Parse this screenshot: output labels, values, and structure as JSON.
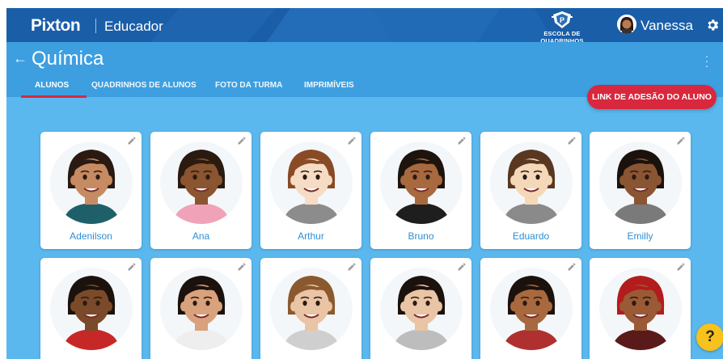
{
  "header": {
    "logo": "Pixton",
    "product": "Educador",
    "school_label": "ESCOLA DE QUADRINHOS",
    "user_name": "Vanessa"
  },
  "classroom": {
    "title": "Química",
    "tabs": [
      {
        "label": "ALUNOS",
        "active": true
      },
      {
        "label": "QUADRINHOS DE ALUNOS",
        "active": false
      },
      {
        "label": "FOTO DA TURMA",
        "active": false
      },
      {
        "label": "IMPRIMÍVEIS",
        "active": false
      }
    ],
    "join_link_button": "LINK DE ADESÃO DO ALUNO"
  },
  "students": [
    {
      "name": "Adenilson",
      "skin": "#c68b62",
      "hair": "#2a1a12",
      "shirt": "#1f5f6a"
    },
    {
      "name": "Ana",
      "skin": "#8a5530",
      "hair": "#2b1a10",
      "shirt": "#f0a3b8"
    },
    {
      "name": "Arthur",
      "skin": "#f6dcc4",
      "hair": "#8a4a26",
      "shirt": "#8c8c8c"
    },
    {
      "name": "Bruno",
      "skin": "#a8693e",
      "hair": "#1e140e",
      "shirt": "#1e1e1e"
    },
    {
      "name": "Eduardo",
      "skin": "#f5d8b8",
      "hair": "#5a3720",
      "shirt": "#8a8a8a"
    },
    {
      "name": "Emilly",
      "skin": "#8a5533",
      "hair": "#1b120d",
      "shirt": "#7a7a7a"
    },
    {
      "name": "",
      "skin": "#7a4a2a",
      "hair": "#1b120d",
      "shirt": "#c62828"
    },
    {
      "name": "",
      "skin": "#d9a27c",
      "hair": "#1b120d",
      "shirt": "#eeeeee"
    },
    {
      "name": "",
      "skin": "#e9c4a5",
      "hair": "#8a5a2e",
      "shirt": "#cfcfcf"
    },
    {
      "name": "",
      "skin": "#e9c4a5",
      "hair": "#1b120d",
      "shirt": "#bdbdbd"
    },
    {
      "name": "",
      "skin": "#a8693e",
      "hair": "#1b120d",
      "shirt": "#b03030"
    },
    {
      "name": "",
      "skin": "#9a5a36",
      "hair": "#b31c1c",
      "shirt": "#5a1a1a"
    }
  ],
  "help_label": "?"
}
